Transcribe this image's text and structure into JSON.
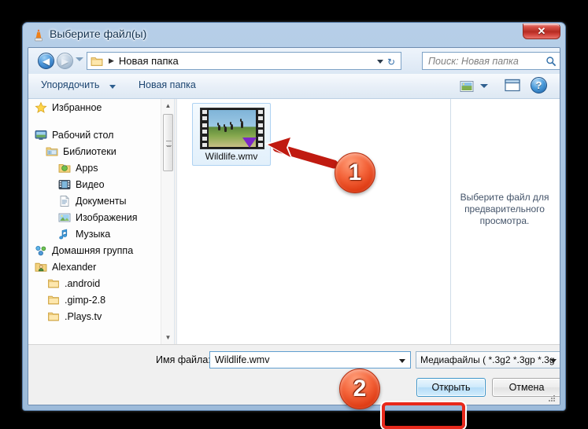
{
  "window": {
    "title": "Выберите файл(ы)",
    "title_icon": "vlc-cone-icon",
    "close_label": "✕"
  },
  "navbar": {
    "back_icon": "back-arrow-icon",
    "back_glyph": "◀",
    "forward_icon": "forward-arrow-icon",
    "forward_glyph": "▶",
    "history_icon": "chevron-down-icon",
    "address": {
      "folder_icon": "folder-icon",
      "separator": "▶",
      "path": "Новая папка",
      "dropdown_icon": "chevron-down-icon",
      "refresh_icon": "refresh-icon",
      "refresh_glyph": "↻"
    },
    "search": {
      "placeholder": "Поиск: Новая папка",
      "icon": "search-icon"
    }
  },
  "toolbar": {
    "organize_label": "Упорядочить",
    "organize_arrow_icon": "chevron-down-icon",
    "new_folder_label": "Новая папка",
    "view_icon": "view-mode-icon",
    "view_arrow_icon": "chevron-down-icon",
    "preview_pane_icon": "preview-pane-icon",
    "help_icon": "help-icon",
    "help_label": "?"
  },
  "sidebar": {
    "items": [
      {
        "label": "Избранное",
        "icon": "star-icon",
        "indent": 8,
        "gap_after": 14
      },
      {
        "label": "Рабочий стол",
        "icon": "desktop-icon",
        "indent": 8,
        "gap_after": 0
      },
      {
        "label": "Библиотеки",
        "icon": "libraries-icon",
        "indent": 22,
        "gap_after": 0
      },
      {
        "label": "Apps",
        "icon": "apps-folder-icon",
        "indent": 38,
        "gap_after": 0
      },
      {
        "label": "Видео",
        "icon": "video-library-icon",
        "indent": 38,
        "gap_after": 0
      },
      {
        "label": "Документы",
        "icon": "documents-icon",
        "indent": 38,
        "gap_after": 0
      },
      {
        "label": "Изображения",
        "icon": "pictures-icon",
        "indent": 38,
        "gap_after": 0
      },
      {
        "label": "Музыка",
        "icon": "music-note-icon",
        "indent": 38,
        "gap_after": 0
      },
      {
        "label": "Домашняя группа",
        "icon": "homegroup-icon",
        "indent": 8,
        "gap_after": 0
      },
      {
        "label": "Alexander",
        "icon": "user-folder-icon",
        "indent": 8,
        "gap_after": 0
      },
      {
        "label": ".android",
        "icon": "folder-icon",
        "indent": 24,
        "gap_after": 0
      },
      {
        "label": ".gimp-2.8",
        "icon": "folder-icon",
        "indent": 24,
        "gap_after": 0
      },
      {
        "label": ".Plays.tv",
        "icon": "folder-icon",
        "indent": 24,
        "gap_after": 0
      }
    ],
    "scroll_up_icon": "scroll-up-arrow-icon",
    "scroll_up_glyph": "▲",
    "scroll_down_icon": "scroll-down-arrow-icon",
    "scroll_down_glyph": "▼"
  },
  "file_list": {
    "items": [
      {
        "name": "Wildlife.wmv",
        "icon": "video-thumbnail-icon",
        "selected": true,
        "overlay": "wmp-badge"
      }
    ]
  },
  "preview_pane": {
    "message": "Выберите файл для предварительного просмотра."
  },
  "bottom": {
    "filename_label": "Имя файла:",
    "filename_value": "Wildlife.wmv",
    "filename_dropdown_icon": "chevron-down-icon",
    "filter_value": "Медиафайлы ( *.3g2 *.3gp *.3g",
    "filter_dropdown_icon": "chevron-down-icon",
    "open_label": "Открыть",
    "cancel_label": "Отмена",
    "resize_grip_icon": "resize-grip-icon"
  },
  "annotations": {
    "badge_1": "1",
    "badge_2": "2",
    "arrow_icon": "red-arrow-icon",
    "highlight_icon": "red-highlight-ring",
    "accent_color": "#e8291c",
    "badge_color": "#f4643a"
  }
}
